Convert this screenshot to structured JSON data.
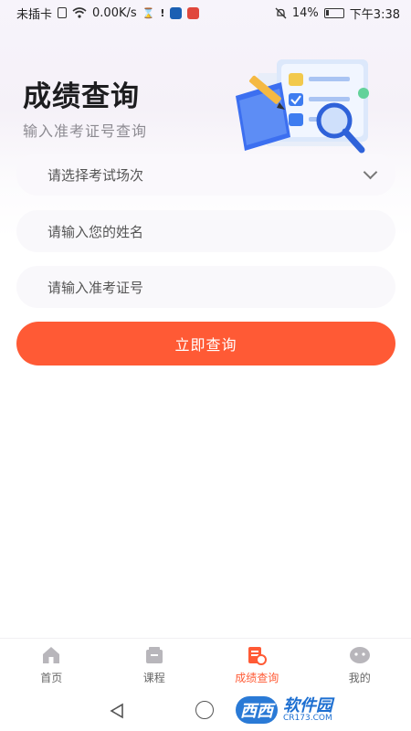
{
  "status_bar": {
    "carrier": "未插卡",
    "speed": "0.00K/s",
    "battery": "14%",
    "time": "下午3:38"
  },
  "header": {
    "title": "成绩查询",
    "subtitle": "输入准考证号查询"
  },
  "form": {
    "exam_session_placeholder": "请选择考试场次",
    "name_placeholder": "请输入您的姓名",
    "ticket_placeholder": "请输入准考证号",
    "submit_label": "立即查询"
  },
  "tabbar": {
    "items": [
      {
        "label": "首页",
        "icon": "home-icon",
        "active": false
      },
      {
        "label": "课程",
        "icon": "course-icon",
        "active": false
      },
      {
        "label": "成绩查询",
        "icon": "score-query-icon",
        "active": true
      },
      {
        "label": "我的",
        "icon": "profile-icon",
        "active": false
      }
    ]
  },
  "watermark": {
    "brand": "西西",
    "name": "软件园",
    "site": "CR173.COM"
  },
  "colors": {
    "accent": "#ff5a35",
    "title": "#1d1d1f",
    "subtitle": "#8d8b92"
  }
}
